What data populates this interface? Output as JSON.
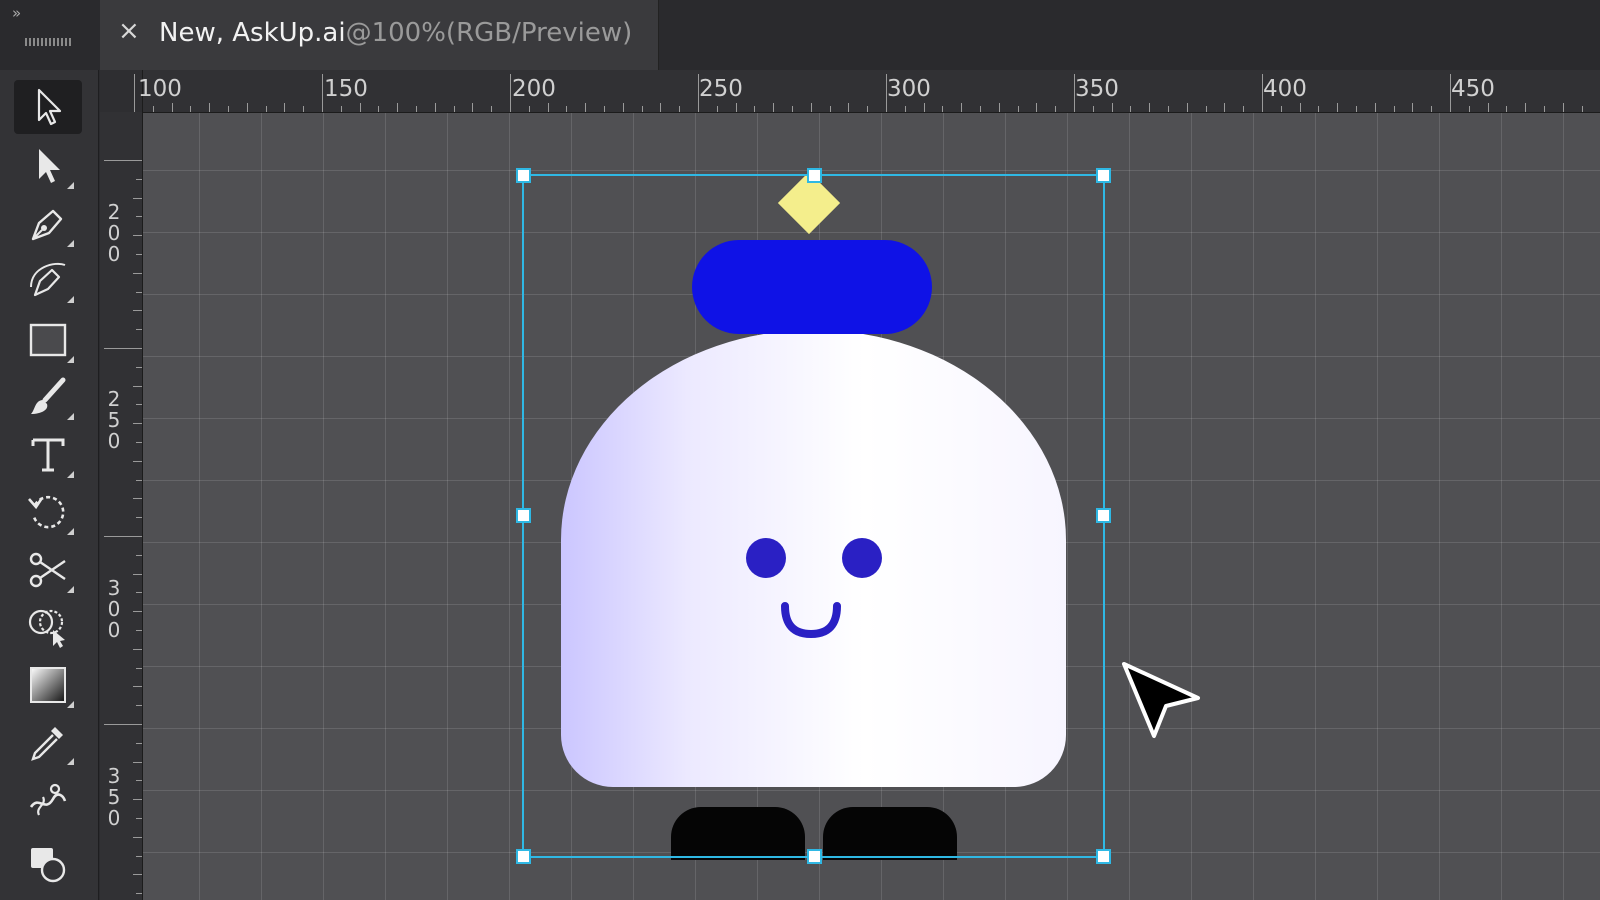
{
  "tab": {
    "close_glyph": "×",
    "file_name": "New, AskUp.ai",
    "view_mode": "@100%(RGB/Preview)"
  },
  "toolbar": {
    "collapse_glyph": "»",
    "tools": [
      {
        "name": "selection-tool",
        "icon": "arrow-outline-icon",
        "active": true
      },
      {
        "name": "direct-selection-tool",
        "icon": "arrow-filled-icon"
      },
      {
        "name": "pen-tool",
        "icon": "pen-icon"
      },
      {
        "name": "curvature-tool",
        "icon": "curvature-pen-icon"
      },
      {
        "name": "rectangle-tool",
        "icon": "rectangle-icon"
      },
      {
        "name": "paintbrush-tool",
        "icon": "paintbrush-icon"
      },
      {
        "name": "type-tool",
        "icon": "type-icon"
      },
      {
        "name": "rotate-tool",
        "icon": "rotate-icon"
      },
      {
        "name": "scissors-tool",
        "icon": "scissors-icon"
      },
      {
        "name": "shape-builder-tool",
        "icon": "shape-builder-icon"
      },
      {
        "name": "gradient-tool",
        "icon": "gradient-icon"
      },
      {
        "name": "eyedropper-tool",
        "icon": "eyedropper-icon"
      },
      {
        "name": "puppet-warp-tool",
        "icon": "puppet-warp-icon"
      },
      {
        "name": "fill-stroke-swatch",
        "icon": "fill-stroke-icon"
      }
    ]
  },
  "rulers": {
    "horizontal": [
      "100",
      "150",
      "200",
      "250",
      "300",
      "350",
      "400",
      "450"
    ],
    "vertical": [
      "200",
      "250",
      "300",
      "350"
    ]
  },
  "artwork": {
    "antenna_color": "#f4ee8c",
    "hat_color": "#0f12e6",
    "body_gradient": [
      "#cbc6ff",
      "#ffffff"
    ],
    "face_color": "#2a20c4",
    "feet_color": "#050505",
    "selection_color": "#2fb8e4"
  }
}
